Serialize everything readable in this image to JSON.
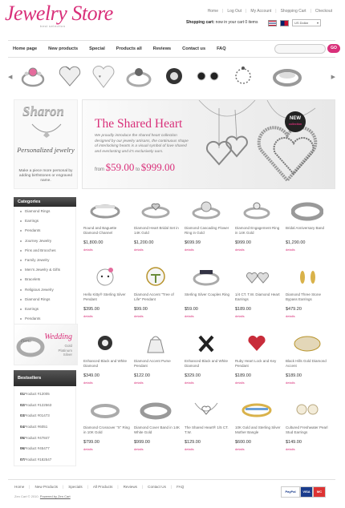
{
  "header": {
    "logo": "Jewelry Store",
    "tagline": "best selection",
    "top_links": [
      "Home",
      "Log Out",
      "My Account",
      "Shopping Cart",
      "Checkout"
    ],
    "cart_label": "Shopping cart:",
    "cart_status": "now in your cart 0 items",
    "currency": "US Dollar"
  },
  "nav": {
    "items": [
      "Home page",
      "New products",
      "Special",
      "Products all",
      "Reviews",
      "Contact us",
      "FAQ"
    ],
    "search_button": "GO"
  },
  "promo": {
    "name": "Sharon",
    "title": "Personalized jewelry",
    "text": "Make a piece more personal by adding birthstones or engraved name."
  },
  "banner": {
    "title": "The Shared Heart",
    "text": "We proudly introduce the shared heart collection designed by our jewelry artisans, the continuous shape of interlocking hearts is a visual symbol of love shared and everlasting and it's exclusively ours.",
    "from_label": "from",
    "price_from": "$59.00",
    "to_label": "to",
    "price_to": "$999.00",
    "badge_new": "NEW",
    "badge_sub": "collection"
  },
  "categories": {
    "title": "Categories",
    "items": [
      "Diamond Rings",
      "Earrings",
      "Pendants",
      "Journey Jewelry",
      "Pins and Brooches",
      "Family Jewelry",
      "Men's Jewelry & Gifts",
      "Bracelets",
      "Religious Jewelry",
      "Diamond Rings",
      "Earrings",
      "Pendants"
    ]
  },
  "wedding": {
    "title": "Wedding",
    "sub1": "Gold",
    "sub2": "Platinum",
    "sub3": "Silver",
    "engraving": "Fleeta"
  },
  "bestsellers": {
    "title": "Bestsellers",
    "items": [
      {
        "num": "01.",
        "label": "Product #12005"
      },
      {
        "num": "02.",
        "label": "Product #122563"
      },
      {
        "num": "03.",
        "label": "Product #01473"
      },
      {
        "num": "04.",
        "label": "Product #6051"
      },
      {
        "num": "05.",
        "label": "Product #47847"
      },
      {
        "num": "06.",
        "label": "Product #45477"
      },
      {
        "num": "07.",
        "label": "Product #182547"
      }
    ]
  },
  "products": [
    {
      "name": "Round and Baguette Diamond Channel",
      "price": "$1,800.00",
      "details": "details"
    },
    {
      "name": "Diamond Heart Bridal Set in 14K Gold",
      "price": "$1,200.00",
      "details": "details"
    },
    {
      "name": "Diamond Cascading Flower Ring in Gold",
      "price": "$699.99",
      "details": "details"
    },
    {
      "name": "Diamond Engagement Ring in 14K Gold",
      "price": "$999.00",
      "details": "details"
    },
    {
      "name": "Bridal Anniversary Band",
      "price": "$1,290.00",
      "details": "details"
    },
    {
      "name": "Hello Kitty® Sterling Silver Pendant",
      "price": "$395.00",
      "details": "details"
    },
    {
      "name": "Diamond Accent \"Tree of Life\" Pendant",
      "price": "$99.00",
      "details": "details"
    },
    {
      "name": "Sterling Silver Couples Ring",
      "price": "$59.00",
      "details": "details"
    },
    {
      "name": "1/4 CT. T.W. Diamond Heart Earrings",
      "price": "$189.00",
      "details": "details"
    },
    {
      "name": "Diamond Three Stone Bypass Earrings",
      "price": "$479.20",
      "details": "details"
    },
    {
      "name": "Enhanced Black and White Diamond",
      "price": "$349.00",
      "details": "details"
    },
    {
      "name": "Diamond Accent Purse Pendant",
      "price": "$122.00",
      "details": "details"
    },
    {
      "name": "Enhanced Black and White Diamond",
      "price": "$329.00",
      "details": "details"
    },
    {
      "name": "Ruby Heart Lock and Key Pendant",
      "price": "$189.00",
      "details": "details"
    },
    {
      "name": "Black Hills Gold Diamond Accent",
      "price": "$189.00",
      "details": "details"
    },
    {
      "name": "Diamond Crossover \"X\" Ring in 10K Gold",
      "price": "$799.00",
      "details": "details"
    },
    {
      "name": "Diamond Cover Band in 14K White Gold",
      "price": "$999.00",
      "details": "details"
    },
    {
      "name": "The Shared Heart® 1/5 CT. T.W.",
      "price": "$129.00",
      "details": "details"
    },
    {
      "name": "10K Gold and Sterling Silver Mother Bangle",
      "price": "$600.00",
      "details": "details"
    },
    {
      "name": "Cultured Freshwater Pearl Stud Earrings",
      "price": "$149.00",
      "details": "details"
    }
  ],
  "footer": {
    "links": [
      "Home",
      "New Products",
      "Specials",
      "All Products",
      "Reviews",
      "Contact Us",
      "FAQ"
    ],
    "copyright": "Zen Cart © 2010",
    "powered": "Powered by Zen Cart",
    "payments": [
      "PayPal",
      "VISA",
      "MC"
    ]
  },
  "colors": {
    "accent": "#d9307a",
    "dark_header": "#2b2b2b"
  }
}
